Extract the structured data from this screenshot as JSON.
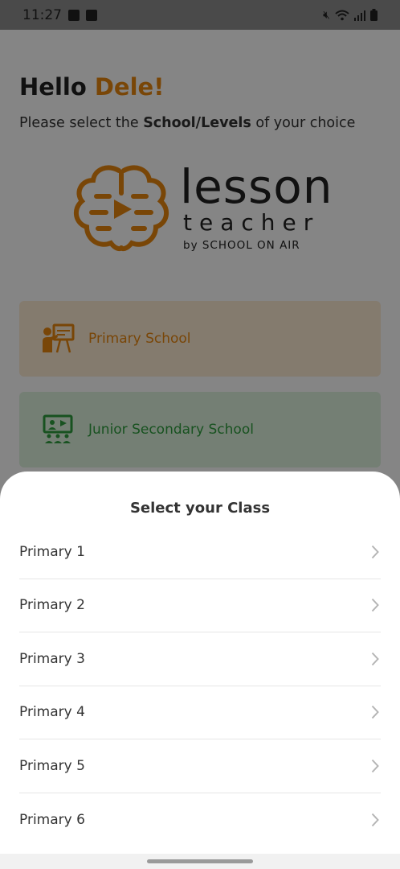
{
  "status_bar": {
    "time": "11:27",
    "icons": [
      "image-notification-icon",
      "checkbox-notification-icon",
      "mute-icon",
      "wifi-icon",
      "signal-icon",
      "battery-icon"
    ]
  },
  "header": {
    "greeting_prefix": "Hello ",
    "user_name": "Dele!",
    "subtitle_prefix": "Please select the ",
    "subtitle_bold": "School/Levels",
    "subtitle_suffix": " of your choice"
  },
  "logo": {
    "word": "lesson",
    "sub": "teacher",
    "byline": "by SCHOOL ON AIR",
    "color": "#e8860f"
  },
  "levels": [
    {
      "label": "Primary School",
      "icon": "teacher-board-icon",
      "bg": "#fdebd3",
      "color": "#e8860f"
    },
    {
      "label": "Junior Secondary School",
      "icon": "online-class-icon",
      "bg": "#dff3df",
      "color": "#2e9e3e"
    }
  ],
  "sheet": {
    "title": "Select your Class",
    "items": [
      {
        "label": "Primary 1"
      },
      {
        "label": "Primary 2"
      },
      {
        "label": "Primary 3"
      },
      {
        "label": "Primary 4"
      },
      {
        "label": "Primary 5"
      },
      {
        "label": "Primary 6"
      }
    ]
  }
}
